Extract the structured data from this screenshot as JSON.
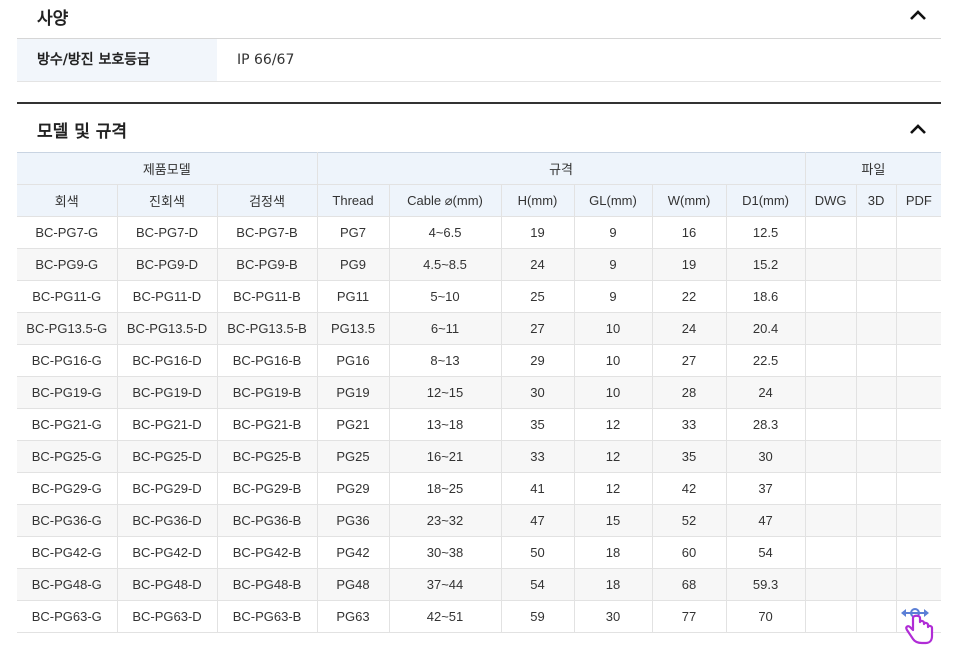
{
  "spec": {
    "title": "사양",
    "rows": [
      {
        "label": "방수/방진 보호등급",
        "value": "IP 66/67"
      }
    ]
  },
  "models": {
    "title": "모델 및 규격",
    "group_headers": [
      "제품모델",
      "규격",
      "파일"
    ],
    "columns": [
      "회색",
      "진회색",
      "검정색",
      "Thread",
      "Cable ⌀(mm)",
      "H(mm)",
      "GL(mm)",
      "W(mm)",
      "D1(mm)",
      "DWG",
      "3D",
      "PDF"
    ],
    "rows": [
      [
        "BC-PG7-G",
        "BC-PG7-D",
        "BC-PG7-B",
        "PG7",
        "4~6.5",
        "19",
        "9",
        "16",
        "12.5",
        "",
        "",
        ""
      ],
      [
        "BC-PG9-G",
        "BC-PG9-D",
        "BC-PG9-B",
        "PG9",
        "4.5~8.5",
        "24",
        "9",
        "19",
        "15.2",
        "",
        "",
        ""
      ],
      [
        "BC-PG11-G",
        "BC-PG11-D",
        "BC-PG11-B",
        "PG11",
        "5~10",
        "25",
        "9",
        "22",
        "18.6",
        "",
        "",
        ""
      ],
      [
        "BC-PG13.5-G",
        "BC-PG13.5-D",
        "BC-PG13.5-B",
        "PG13.5",
        "6~11",
        "27",
        "10",
        "24",
        "20.4",
        "",
        "",
        ""
      ],
      [
        "BC-PG16-G",
        "BC-PG16-D",
        "BC-PG16-B",
        "PG16",
        "8~13",
        "29",
        "10",
        "27",
        "22.5",
        "",
        "",
        ""
      ],
      [
        "BC-PG19-G",
        "BC-PG19-D",
        "BC-PG19-B",
        "PG19",
        "12~15",
        "30",
        "10",
        "28",
        "24",
        "",
        "",
        ""
      ],
      [
        "BC-PG21-G",
        "BC-PG21-D",
        "BC-PG21-B",
        "PG21",
        "13~18",
        "35",
        "12",
        "33",
        "28.3",
        "",
        "",
        ""
      ],
      [
        "BC-PG25-G",
        "BC-PG25-D",
        "BC-PG25-B",
        "PG25",
        "16~21",
        "33",
        "12",
        "35",
        "30",
        "",
        "",
        ""
      ],
      [
        "BC-PG29-G",
        "BC-PG29-D",
        "BC-PG29-B",
        "PG29",
        "18~25",
        "41",
        "12",
        "42",
        "37",
        "",
        "",
        ""
      ],
      [
        "BC-PG36-G",
        "BC-PG36-D",
        "BC-PG36-B",
        "PG36",
        "23~32",
        "47",
        "15",
        "52",
        "47",
        "",
        "",
        ""
      ],
      [
        "BC-PG42-G",
        "BC-PG42-D",
        "BC-PG42-B",
        "PG42",
        "30~38",
        "50",
        "18",
        "60",
        "54",
        "",
        "",
        ""
      ],
      [
        "BC-PG48-G",
        "BC-PG48-D",
        "BC-PG48-B",
        "PG48",
        "37~44",
        "54",
        "18",
        "68",
        "59.3",
        "",
        "",
        ""
      ],
      [
        "BC-PG63-G",
        "BC-PG63-D",
        "BC-PG63-B",
        "PG63",
        "42~51",
        "59",
        "30",
        "77",
        "70",
        "",
        "",
        ""
      ]
    ]
  },
  "icons": {
    "collapse": "chevron-up-icon",
    "cursor": "scroll-hand-cursor-icon"
  },
  "colors": {
    "header_bg": "#eef4fb",
    "label_bg": "#f2f6fb",
    "accent_purple": "#b02cd6"
  }
}
